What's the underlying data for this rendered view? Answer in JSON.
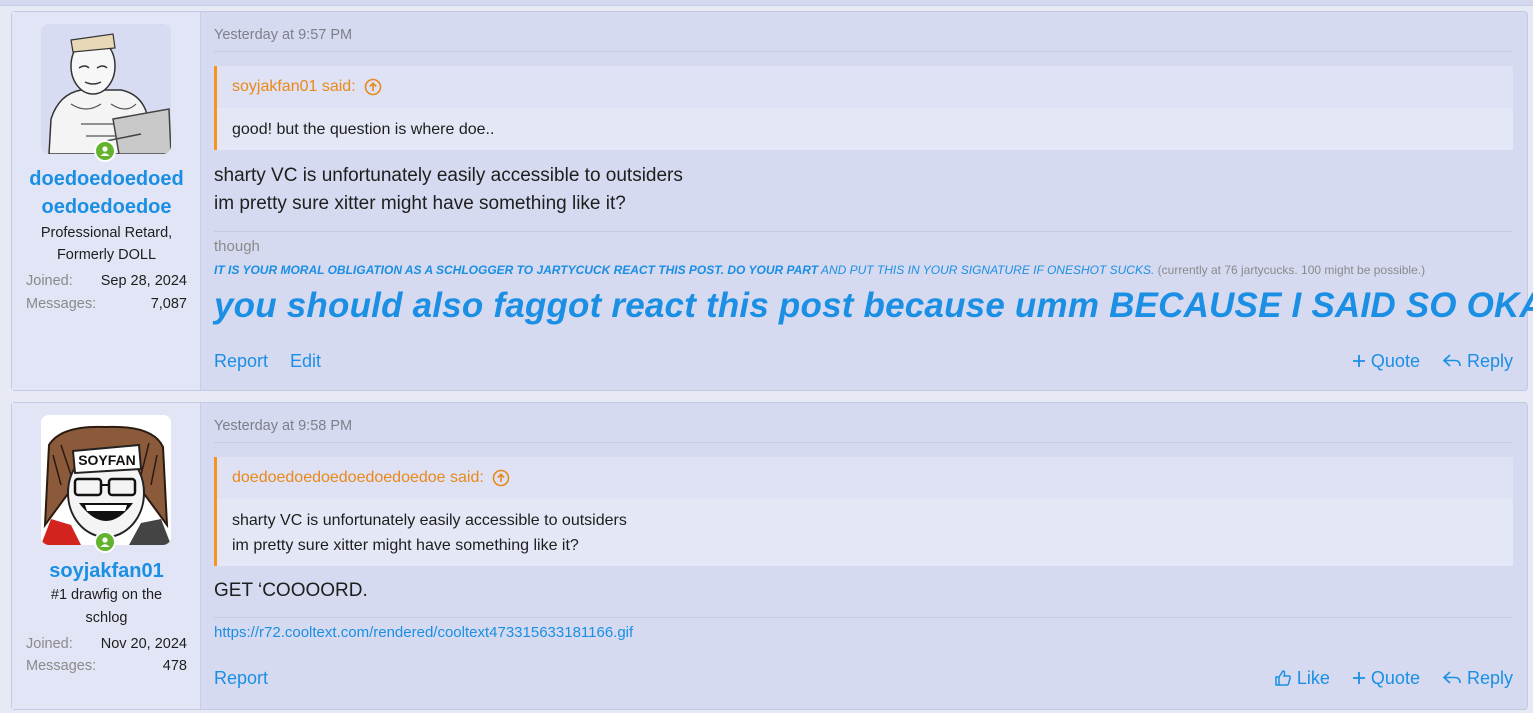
{
  "posts": [
    {
      "user": {
        "name_line1": "doedoedoedoed",
        "name_line2": "oedoedoedoe",
        "title_line1": "Professional Retard,",
        "title_line2": "Formerly DOLL",
        "joined_label": "Joined:",
        "joined": "Sep 28, 2024",
        "messages_label": "Messages:",
        "messages": "7,087"
      },
      "date": "Yesterday at 9:57 PM",
      "quote": {
        "author": "soyjakfan01 said:",
        "text": "good! but the question is where doe.."
      },
      "body": [
        "sharty VC is unfortunately easily accessible to outsiders",
        "im pretty sure xitter might have something like it?"
      ],
      "signature": {
        "small": "though",
        "line_bold": "IT IS YOUR MORAL OBLIGATION AS A SCHLOGGER TO JARTYCUCK REACT THIS POST. DO YOUR PART",
        "line_rest": " AND PUT THIS IN YOUR SIGNATURE IF ONESHOT SUCKS.",
        "line_muted": " (currently at 76 jartycucks. 100 might be possible.)",
        "big": "you should also faggot react this post because umm BECAUSE I SAID SO OKAY"
      },
      "actions": {
        "report": "Report",
        "edit": "Edit",
        "quote": "Quote",
        "reply": "Reply"
      }
    },
    {
      "user": {
        "name_line1": "soyjakfan01",
        "title_line1": "#1 drawfig on the",
        "title_line2": "schlog",
        "joined_label": "Joined:",
        "joined": "Nov 20, 2024",
        "messages_label": "Messages:",
        "messages": "478",
        "avatar_text": "SOYFAN"
      },
      "date": "Yesterday at 9:58 PM",
      "quote": {
        "author": "doedoedoedoedoedoedoedoe said:",
        "text_line1": "sharty VC is unfortunately easily accessible to outsiders",
        "text_line2": "im pretty sure xitter might have something like it?"
      },
      "body": [
        "GET ‘COOOORD."
      ],
      "link": "https://r72.cooltext.com/rendered/cooltext473315633181166.gif",
      "actions": {
        "report": "Report",
        "like": "Like",
        "quote": "Quote",
        "reply": "Reply"
      }
    }
  ],
  "colors": {
    "link": "#1a8fe3",
    "quote_accent": "#f7941d",
    "online": "#63b32f"
  }
}
